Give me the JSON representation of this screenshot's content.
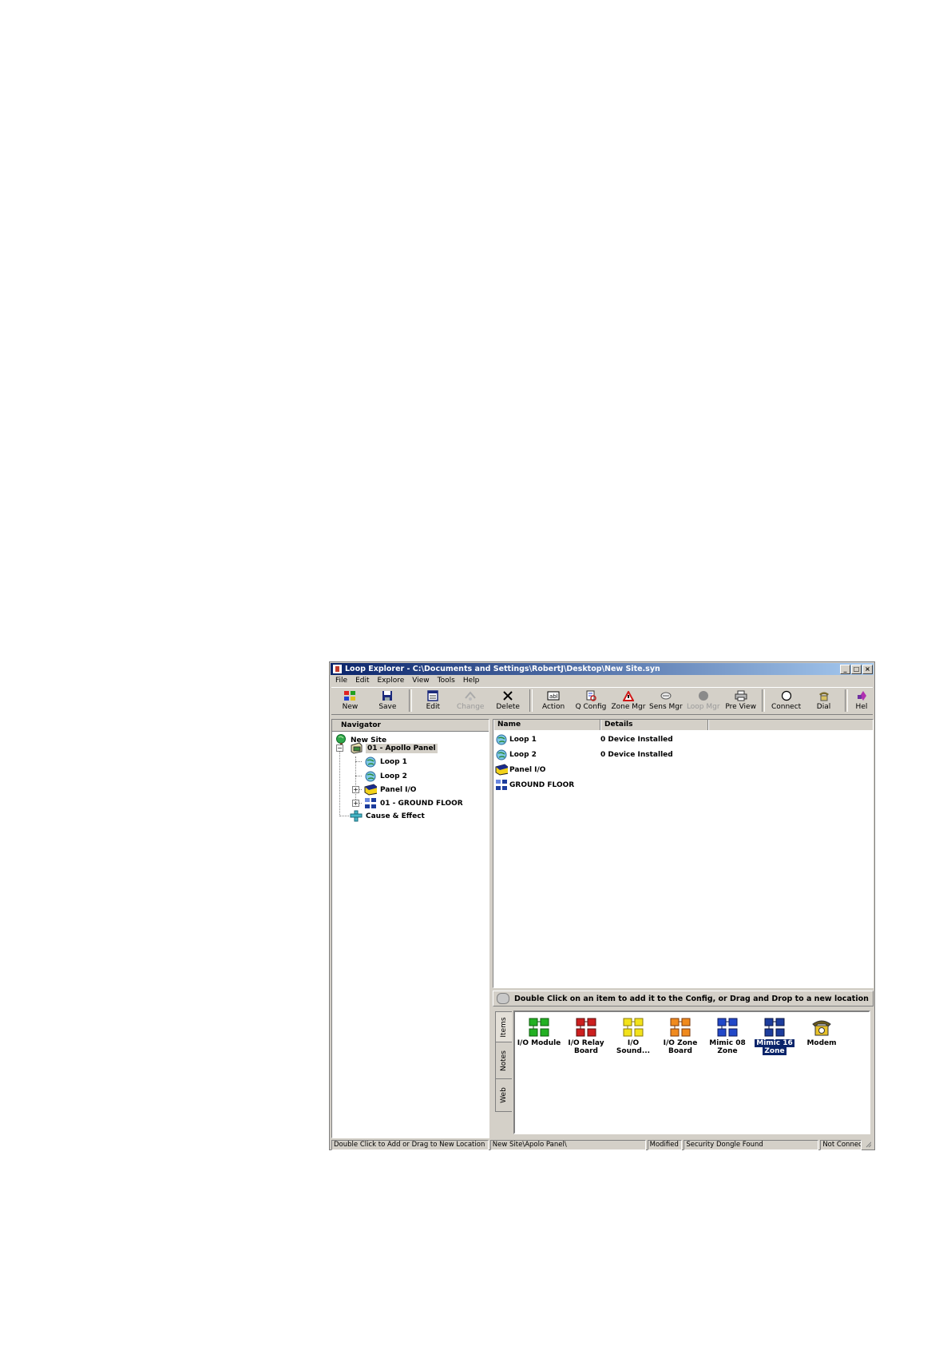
{
  "window": {
    "title": "Loop Explorer - C:\\Documents and Settings\\RobertJ\\Desktop\\New Site.syn",
    "controls": [
      "_",
      "□",
      "×"
    ]
  },
  "menu": [
    "File",
    "Edit",
    "Explore",
    "View",
    "Tools",
    "Help"
  ],
  "toolbar": {
    "new": "New",
    "save": "Save",
    "edit": "Edit",
    "change": "Change",
    "delete": "Delete",
    "action": "Action",
    "qconfig": "Q Config",
    "zonemgr": "Zone Mgr",
    "sensmgr": "Sens Mgr",
    "loopmgr": "Loop Mgr",
    "preview": "Pre View",
    "connect": "Connect",
    "dial": "Dial",
    "help": "Hel"
  },
  "navigator": {
    "header": "Navigator",
    "items": [
      {
        "label": "New Site",
        "icon": "globe-tree-icon"
      },
      {
        "label": "01 - Apollo Panel",
        "icon": "panel-icon"
      },
      {
        "label": "Loop 1",
        "icon": "loop-globe-icon"
      },
      {
        "label": "Loop 2",
        "icon": "loop-globe-icon"
      },
      {
        "label": "Panel I/O",
        "icon": "panel-io-icon"
      },
      {
        "label": "01 - GROUND FLOOR",
        "icon": "zone-icon"
      },
      {
        "label": "Cause & Effect",
        "icon": "cause-effect-icon"
      }
    ]
  },
  "list": {
    "columns": [
      "Name",
      "Details"
    ],
    "rows": [
      {
        "name": "Loop 1",
        "details": "0 Device Installed"
      },
      {
        "name": "Loop 2",
        "details": "0 Device Installed"
      },
      {
        "name": "Panel I/O",
        "details": ""
      },
      {
        "name": "GROUND FLOOR",
        "details": ""
      }
    ]
  },
  "palette": {
    "hint": "Double Click on an item to add it to the Config, or Drag and Drop to a new location",
    "tabs": [
      "Items",
      "Notes",
      "Web"
    ],
    "items": [
      {
        "line1": "I/O Module",
        "line2": "",
        "color": "#22b022"
      },
      {
        "line1": "I/O Relay",
        "line2": "Board",
        "color": "#cc1f1f"
      },
      {
        "line1": "I/O",
        "line2": "Sound...",
        "color": "#f2e21a"
      },
      {
        "line1": "I/O Zone",
        "line2": "Board",
        "color": "#f08a1e"
      },
      {
        "line1": "Mimic 08",
        "line2": "Zone",
        "color": "#2248c8"
      },
      {
        "line1": "Mimic 16",
        "line2": "Zone",
        "color": "#1c3c9c"
      },
      {
        "line1": "Modem",
        "line2": "",
        "color": "#e8c228"
      }
    ],
    "selected": "Mimic 16"
  },
  "status": {
    "hint": "Double Click to Add or Drag to New Location",
    "path": "New Site\\Apolo Panel\\",
    "modified": "Modified",
    "dongle": "Security Dongle Found",
    "connection": "Not Connec"
  }
}
